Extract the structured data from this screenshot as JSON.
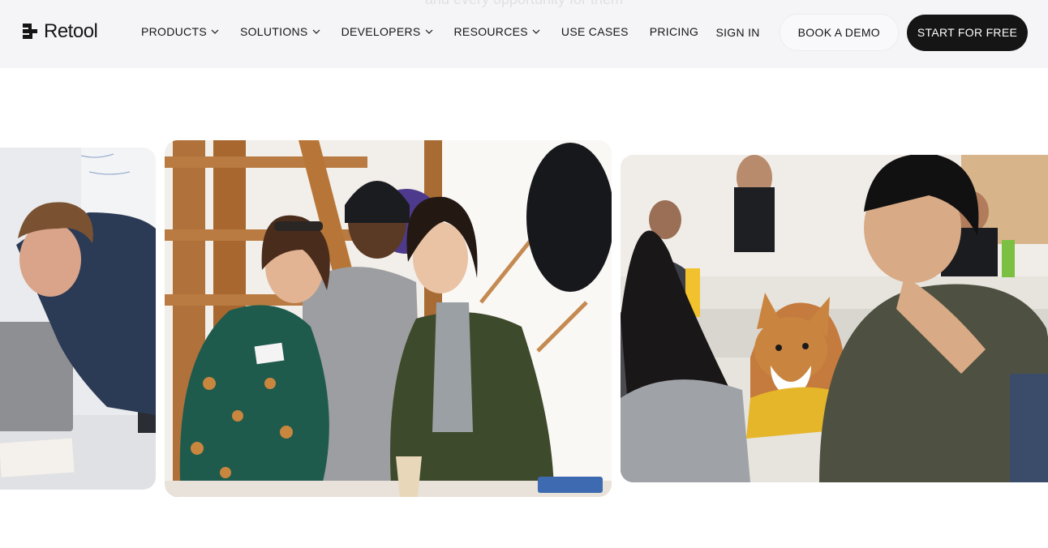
{
  "header": {
    "logo_text": "Retool",
    "nav": [
      {
        "label": "PRODUCTS",
        "has_dropdown": true
      },
      {
        "label": "SOLUTIONS",
        "has_dropdown": true
      },
      {
        "label": "DEVELOPERS",
        "has_dropdown": true
      },
      {
        "label": "RESOURCES",
        "has_dropdown": true
      },
      {
        "label": "USE CASES",
        "has_dropdown": false
      },
      {
        "label": "PRICING",
        "has_dropdown": false
      }
    ],
    "sign_in_label": "SIGN IN",
    "book_demo_label": "BOOK A DEMO",
    "start_label": "START FOR FREE",
    "faded_text": "and every opportunity for them"
  },
  "gallery": {
    "photos": [
      "team-member-at-laptop-photo",
      "three-teammates-smiling-photo",
      "office-corgi-with-team-photo"
    ]
  },
  "colors": {
    "nav_background": "#f5f5f8",
    "primary_button": "#151515",
    "primary_button_text": "#ffffff"
  },
  "icons": [
    "retool-logo-icon",
    "chevron-down-icon"
  ]
}
